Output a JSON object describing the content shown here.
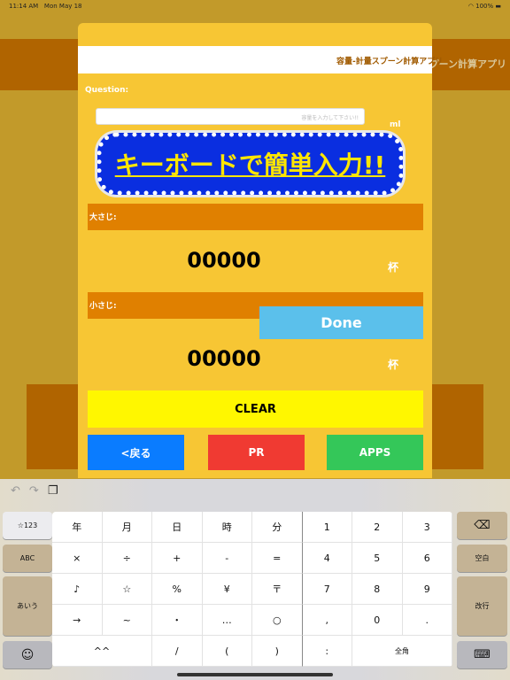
{
  "status": {
    "time": "11:14 AM",
    "date": "Mon May 18",
    "battery": "100%"
  },
  "app": {
    "title": "容量-計量スプーン計算アプリ",
    "background_title": "スプーン計算アプリ",
    "question_label": "Question:",
    "input_placeholder": "容量を入力して下さい!!",
    "input_value": "",
    "unit_ml": "ml",
    "banner": "キーボードで簡単入力!!",
    "tablespoon_label": "大さじ:",
    "tablespoon_value": "00000",
    "teaspoon_label": "小さじ:",
    "teaspoon_value": "00000",
    "cup_unit": "杯",
    "done": "Done",
    "clear": "CLEAR",
    "back": "<戻る",
    "pr": "PR",
    "apps": "APPS",
    "colors": {
      "panel": "#f7c634",
      "bar": "#e08000",
      "banner": "#0a2ee0",
      "done": "#5bc0eb",
      "clear": "#fff700",
      "back": "#0a7cff",
      "pr": "#f03a32",
      "apps": "#34c759"
    }
  },
  "keyboard": {
    "toolbar": [
      "undo-icon",
      "redo-icon",
      "paste-icon"
    ],
    "left": [
      "☆123",
      "ABC",
      "あいう",
      "☺"
    ],
    "right": [
      "⌫",
      "空白",
      "改行",
      "⌨"
    ],
    "rows": [
      [
        "年",
        "月",
        "日",
        "時",
        "分",
        "1",
        "2",
        "3"
      ],
      [
        "×",
        "÷",
        "+",
        "-",
        "=",
        "4",
        "5",
        "6"
      ],
      [
        "♪",
        "☆",
        "%",
        "¥",
        "〒",
        "7",
        "8",
        "9"
      ],
      [
        "→",
        "~",
        "・",
        "…",
        "○",
        ",",
        "0",
        "."
      ]
    ],
    "bottom": [
      "^^",
      "/",
      "(",
      ")",
      ":",
      "全角"
    ]
  }
}
